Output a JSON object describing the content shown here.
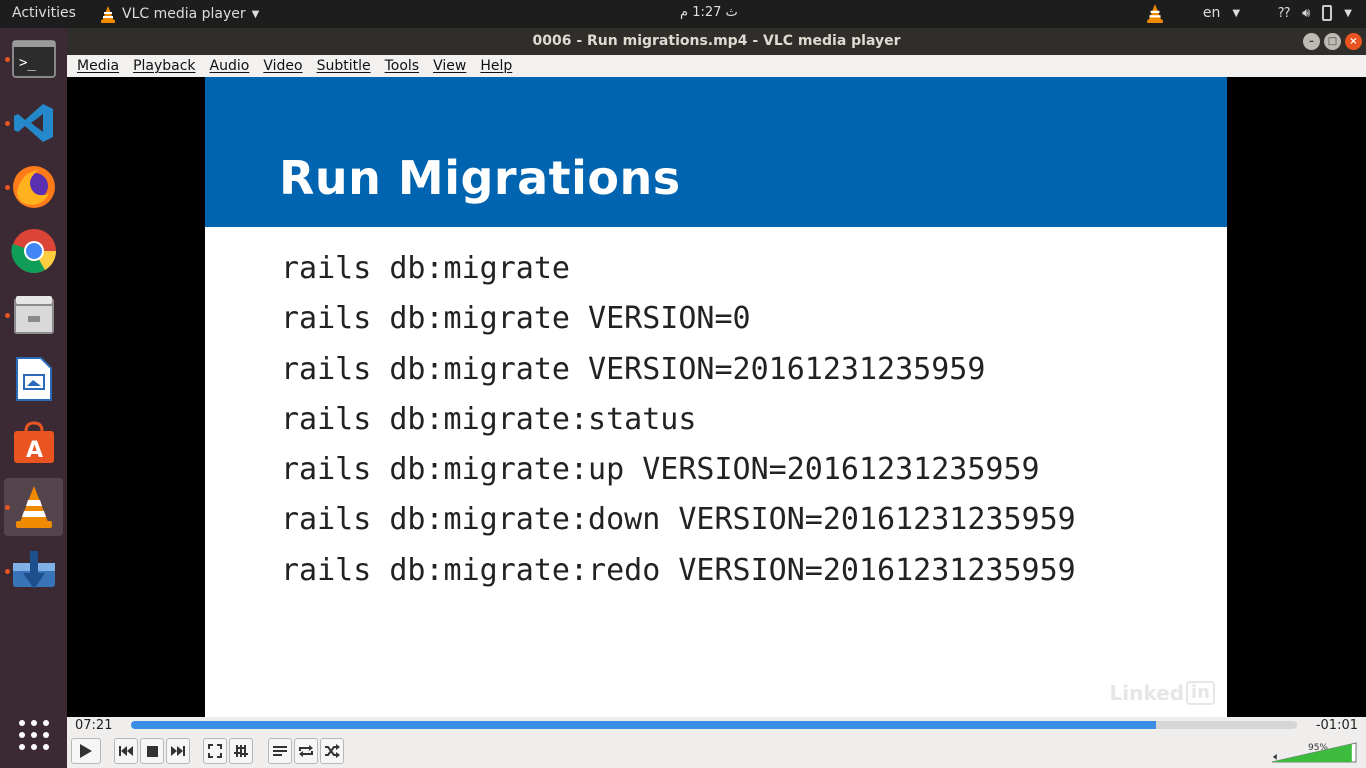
{
  "topbar": {
    "activities": "Activities",
    "app_name": "VLC media player",
    "clock": "ث  1:27 م",
    "lang": "en"
  },
  "window": {
    "title": "0006 - Run migrations.mp4 - VLC media player"
  },
  "menu": [
    "Media",
    "Playback",
    "Audio",
    "Video",
    "Subtitle",
    "Tools",
    "View",
    "Help"
  ],
  "dock": [
    {
      "name": "terminal-icon",
      "running": true,
      "active": false
    },
    {
      "name": "vscode-icon",
      "running": true,
      "active": false
    },
    {
      "name": "firefox-icon",
      "running": true,
      "active": false
    },
    {
      "name": "chrome-icon",
      "running": false,
      "active": false
    },
    {
      "name": "files-icon",
      "running": true,
      "active": false
    },
    {
      "name": "libreoffice-writer-icon",
      "running": false,
      "active": false
    },
    {
      "name": "software-center-icon",
      "running": false,
      "active": false
    },
    {
      "name": "vlc-icon",
      "running": true,
      "active": true
    },
    {
      "name": "downloader-icon",
      "running": true,
      "active": false
    },
    {
      "name": "app-grid-icon",
      "running": false,
      "active": false
    }
  ],
  "slide": {
    "title": "Run Migrations",
    "lines": [
      "rails db:migrate",
      "rails db:migrate VERSION=0",
      "rails db:migrate VERSION=20161231235959",
      "rails db:migrate:status",
      "rails db:migrate:up VERSION=20161231235959",
      "rails db:migrate:down VERSION=20161231235959",
      "rails db:migrate:redo VERSION=20161231235959"
    ],
    "watermark": "Linked",
    "watermark_in": "in"
  },
  "player": {
    "elapsed": "07:21",
    "remaining": "-01:01",
    "progress": 0.879,
    "volume": "95%",
    "volume_level": 0.95
  },
  "colors": {
    "slide_header": "#0064b0",
    "seek_fill": "#3a8ee6",
    "dock_bg": "#3b2a33",
    "accent": "#e95420"
  }
}
